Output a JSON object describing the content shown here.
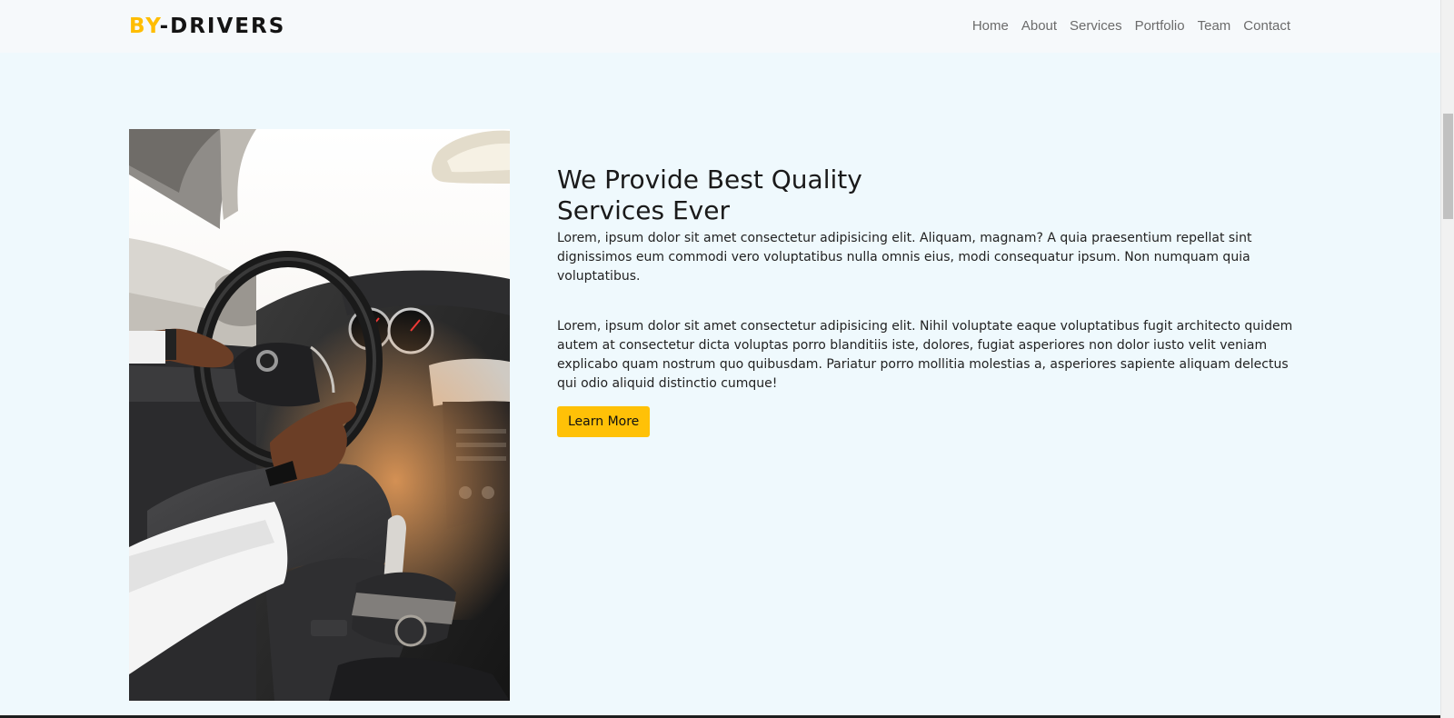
{
  "header": {
    "logo_accent": "BY",
    "logo_rest": "-DRIVERS",
    "nav": [
      "Home",
      "About",
      "Services",
      "Portfolio",
      "Team",
      "Contact"
    ]
  },
  "about": {
    "title": "We Provide Best Quality Services Ever",
    "paragraph_1": "Lorem, ipsum dolor sit amet consectetur adipisicing elit. Aliquam, magnam? A quia praesentium repellat sint dignissimos eum commodi vero voluptatibus nulla omnis eius, modi consequatur ipsum. Non numquam quia voluptatibus.",
    "paragraph_2": "Lorem, ipsum dolor sit amet consectetur adipisicing elit. Nihil voluptate eaque voluptatibus fugit architecto quidem autem at consectetur dicta voluptas porro blanditiis iste, dolores, fugiat asperiores non dolor iusto velit veniam explicabo quam nostrum quo quibusdam. Pariatur porro mollitia molestias a, asperiores sapiente aliquam delectus qui odio aliquid distinctio cumque!",
    "button_label": "Learn More"
  },
  "colors": {
    "accent": "#ffbd00",
    "button": "#ffc107",
    "background": "#eff9fd",
    "header_bg": "#f6f9fb"
  },
  "icons": {
    "photo": "driver-steering-wheel-photo"
  }
}
